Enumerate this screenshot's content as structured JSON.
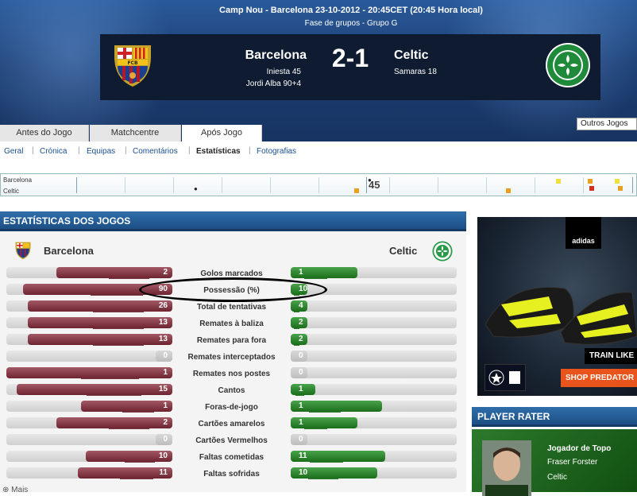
{
  "header": {
    "venue_line": "Camp Nou - Barcelona 23-10-2012 - 20:45CET (20:45 Hora local)",
    "phase_line": "Fase de grupos - Grupo G",
    "home_team": "Barcelona",
    "away_team": "Celtic",
    "score": "2-1",
    "home_scorers": [
      "Iniesta 45",
      "Jordi Alba 90+4"
    ],
    "away_scorers": [
      "Samaras 18"
    ],
    "other_games": "Outros Jogos"
  },
  "tabs": [
    {
      "label": "Antes do Jogo",
      "active": false
    },
    {
      "label": "Matchcentre",
      "active": false
    },
    {
      "label": "Após Jogo",
      "active": true
    }
  ],
  "subnav": [
    {
      "label": "Geral",
      "active": false
    },
    {
      "label": "Crónica",
      "active": false
    },
    {
      "label": "Equipas",
      "active": false
    },
    {
      "label": "Comentários",
      "active": false
    },
    {
      "label": "Estatísticas",
      "active": true
    },
    {
      "label": "Fotografias",
      "active": false
    }
  ],
  "timeline": {
    "home_label": "Barcelona",
    "away_label": "Celtic",
    "half_marker": "45"
  },
  "stats": {
    "title": "ESTATÍSTICAS DOS JOGOS",
    "home_team": "Barcelona",
    "away_team": "Celtic",
    "rows": [
      {
        "label": "Golos marcados",
        "home": "2",
        "away": "1",
        "home_frac": 0.7,
        "away_frac": 0.4
      },
      {
        "label": "Possessão (%)",
        "home": "90",
        "away": "10",
        "home_frac": 0.9,
        "away_frac": 0.1
      },
      {
        "label": "Total de tentativas",
        "home": "26",
        "away": "4",
        "home_frac": 0.87,
        "away_frac": 0.1
      },
      {
        "label": "Remates à baliza",
        "home": "13",
        "away": "2",
        "home_frac": 0.87,
        "away_frac": 0.1
      },
      {
        "label": "Remates para fora",
        "home": "13",
        "away": "2",
        "home_frac": 0.87,
        "away_frac": 0.1
      },
      {
        "label": "Remates interceptados",
        "home": "0",
        "away": "0",
        "home_frac": 0.1,
        "away_frac": 0.1
      },
      {
        "label": "Remates nos postes",
        "home": "1",
        "away": "0",
        "home_frac": 1.0,
        "away_frac": 0.1
      },
      {
        "label": "Cantos",
        "home": "15",
        "away": "1",
        "home_frac": 0.94,
        "away_frac": 0.15
      },
      {
        "label": "Foras-de-jogo",
        "home": "1",
        "away": "1",
        "home_frac": 0.55,
        "away_frac": 0.55
      },
      {
        "label": "Cartões amarelos",
        "home": "2",
        "away": "1",
        "home_frac": 0.7,
        "away_frac": 0.4
      },
      {
        "label": "Cartões Vermelhos",
        "home": "0",
        "away": "0",
        "home_frac": 0.1,
        "away_frac": 0.1
      },
      {
        "label": "Faltas cometidas",
        "home": "10",
        "away": "11",
        "home_frac": 0.52,
        "away_frac": 0.57
      },
      {
        "label": "Faltas sofridas",
        "home": "11",
        "away": "10",
        "home_frac": 0.57,
        "away_frac": 0.52
      }
    ],
    "more_link": "Mais"
  },
  "ad": {
    "brand": "adidas",
    "tagline": "TRAIN LIKE",
    "cta": "SHOP PREDATOR"
  },
  "player_rater": {
    "title": "PLAYER RATER",
    "role": "Jogador de Topo",
    "name": "Fraser Forster",
    "club": "Celtic"
  },
  "colors": {
    "home_bar": "#7a2a36",
    "away_bar": "#2a8a2a",
    "header_blue": "#1c3f74"
  }
}
